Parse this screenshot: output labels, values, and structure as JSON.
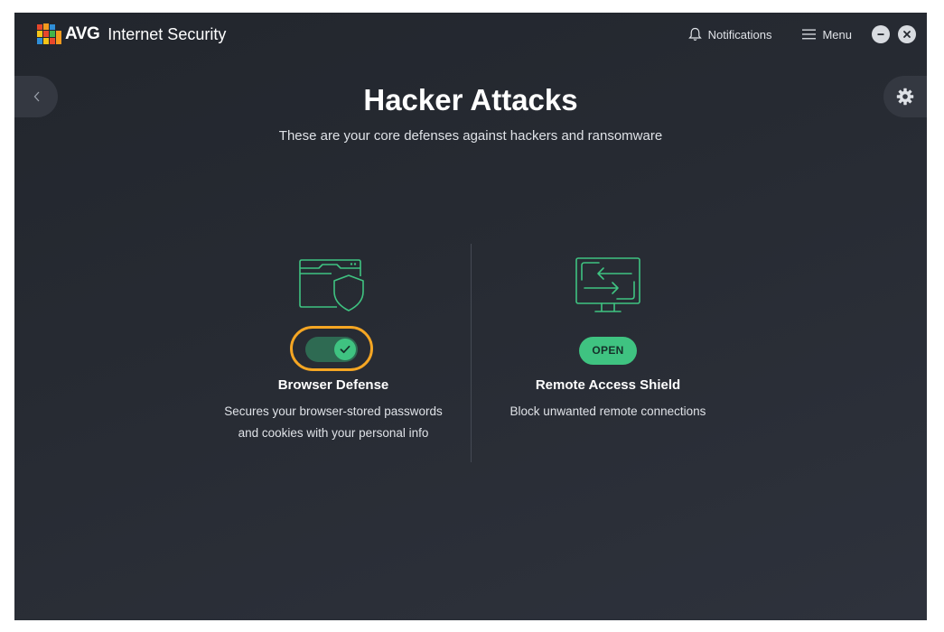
{
  "app": {
    "brand": "AVG",
    "product": "Internet Security"
  },
  "titlebar": {
    "notifications_label": "Notifications",
    "menu_label": "Menu"
  },
  "page": {
    "title": "Hacker Attacks",
    "subtitle": "These are your core defenses against hackers and ransomware"
  },
  "features": [
    {
      "title": "Browser Defense",
      "description_line1": "Secures your browser-stored passwords",
      "description_line2": "and cookies with your personal info",
      "icon": "browser-shield-icon",
      "control": "toggle",
      "enabled": true
    },
    {
      "title": "Remote Access Shield",
      "description_line1": "Block unwanted remote connections",
      "icon": "remote-monitor-icon",
      "control": "button",
      "button_label": "OPEN"
    }
  ],
  "colors": {
    "accent_green": "#3fc381",
    "toggle_track": "#2e6a52",
    "highlight_orange": "#f5a623",
    "background": "#262a32"
  }
}
